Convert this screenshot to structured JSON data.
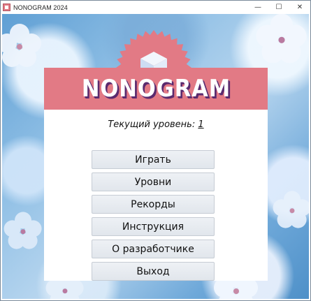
{
  "window": {
    "title": "NONOGRAM 2024",
    "controls": {
      "minimize": "—",
      "maximize": "☐",
      "close": "✕"
    }
  },
  "colors": {
    "header_band": "#e27a85",
    "logo_shadow": "#5a2a6e",
    "burst": "#e27a85",
    "cube_face": "#dfe9f8"
  },
  "header": {
    "logo_text": "NONOGRAM",
    "icon": "cube-icon"
  },
  "level": {
    "label": "Текущий уровень:",
    "value": "1"
  },
  "menu": {
    "play": "Играть",
    "levels": "Уровни",
    "records": "Рекорды",
    "instructions": "Инструкция",
    "about": "О разработчике",
    "exit": "Выход"
  }
}
